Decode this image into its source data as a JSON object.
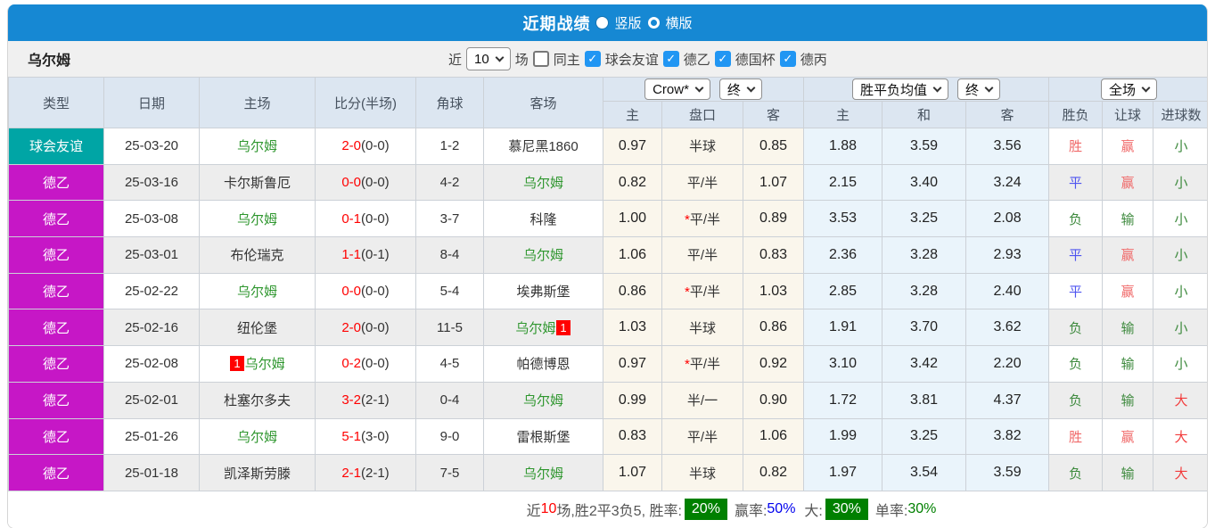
{
  "titlebar": {
    "title": "近期战绩",
    "vertical_label": "竖版",
    "horizontal_label": "横版",
    "vertical_selected": true
  },
  "filter": {
    "team": "乌尔姆",
    "recent_label": "近",
    "match_count": "10",
    "matches_label": "场",
    "same_home_label": "同主",
    "same_home_checked": false,
    "competitions": [
      {
        "label": "球会友谊",
        "checked": true
      },
      {
        "label": "德乙",
        "checked": true
      },
      {
        "label": "德国杯",
        "checked": true
      },
      {
        "label": "德丙",
        "checked": true
      }
    ]
  },
  "table": {
    "selectors": {
      "company": "Crow*",
      "company_time": "终",
      "avg_type": "胜平负均值",
      "avg_time": "终",
      "scope": "全场"
    },
    "columns": [
      "类型",
      "日期",
      "主场",
      "比分(半场)",
      "角球",
      "客场"
    ],
    "sub_columns": [
      "主",
      "盘口",
      "客",
      "主",
      "和",
      "客",
      "胜负",
      "让球",
      "进球数"
    ],
    "rows": [
      {
        "type": "球会友谊",
        "type_color": "teal",
        "date": "25-03-20",
        "home": "乌尔姆",
        "home_focus": true,
        "home_badge_before": "",
        "home_badge_after": "",
        "score_ft": "2-0",
        "score_ht": "(0-0)",
        "corners": "1-2",
        "away": "慕尼黑1860",
        "away_focus": false,
        "away_badge_before": "",
        "away_badge_after": "",
        "odds": [
          "0.97",
          "半球",
          "0.85"
        ],
        "handicap_star": false,
        "avg": [
          "1.88",
          "3.59",
          "3.56"
        ],
        "wdl": "胜",
        "wdl_color": "win-red",
        "handicap_result": "赢",
        "handicap_result_color": "win-red",
        "goals": "小",
        "goals_color": "small-green"
      },
      {
        "type": "德乙",
        "type_color": "magenta",
        "date": "25-03-16",
        "home": "卡尔斯鲁厄",
        "home_focus": false,
        "home_badge_before": "",
        "home_badge_after": "",
        "score_ft": "0-0",
        "score_ht": "(0-0)",
        "corners": "4-2",
        "away": "乌尔姆",
        "away_focus": true,
        "away_badge_before": "",
        "away_badge_after": "",
        "odds": [
          "0.82",
          "平/半",
          "1.07"
        ],
        "handicap_star": false,
        "avg": [
          "2.15",
          "3.40",
          "3.24"
        ],
        "wdl": "平",
        "wdl_color": "draw-blue",
        "handicap_result": "赢",
        "handicap_result_color": "win-red",
        "goals": "小",
        "goals_color": "small-green"
      },
      {
        "type": "德乙",
        "type_color": "magenta",
        "date": "25-03-08",
        "home": "乌尔姆",
        "home_focus": true,
        "home_badge_before": "",
        "home_badge_after": "",
        "score_ft": "0-1",
        "score_ht": "(0-0)",
        "corners": "3-7",
        "away": "科隆",
        "away_focus": false,
        "away_badge_before": "",
        "away_badge_after": "",
        "odds": [
          "1.00",
          "平/半",
          "0.89"
        ],
        "handicap_star": true,
        "avg": [
          "3.53",
          "3.25",
          "2.08"
        ],
        "wdl": "负",
        "wdl_color": "lose-green",
        "handicap_result": "输",
        "handicap_result_color": "lose-green",
        "goals": "小",
        "goals_color": "small-green"
      },
      {
        "type": "德乙",
        "type_color": "magenta",
        "date": "25-03-01",
        "home": "布伦瑞克",
        "home_focus": false,
        "home_badge_before": "",
        "home_badge_after": "",
        "score_ft": "1-1",
        "score_ht": "(0-1)",
        "corners": "8-4",
        "away": "乌尔姆",
        "away_focus": true,
        "away_badge_before": "",
        "away_badge_after": "",
        "odds": [
          "1.06",
          "平/半",
          "0.83"
        ],
        "handicap_star": false,
        "avg": [
          "2.36",
          "3.28",
          "2.93"
        ],
        "wdl": "平",
        "wdl_color": "draw-blue",
        "handicap_result": "赢",
        "handicap_result_color": "win-red",
        "goals": "小",
        "goals_color": "small-green"
      },
      {
        "type": "德乙",
        "type_color": "magenta",
        "date": "25-02-22",
        "home": "乌尔姆",
        "home_focus": true,
        "home_badge_before": "",
        "home_badge_after": "",
        "score_ft": "0-0",
        "score_ht": "(0-0)",
        "corners": "5-4",
        "away": "埃弗斯堡",
        "away_focus": false,
        "away_badge_before": "",
        "away_badge_after": "",
        "odds": [
          "0.86",
          "平/半",
          "1.03"
        ],
        "handicap_star": true,
        "avg": [
          "2.85",
          "3.28",
          "2.40"
        ],
        "wdl": "平",
        "wdl_color": "draw-blue",
        "handicap_result": "赢",
        "handicap_result_color": "win-red",
        "goals": "小",
        "goals_color": "small-green"
      },
      {
        "type": "德乙",
        "type_color": "magenta",
        "date": "25-02-16",
        "home": "纽伦堡",
        "home_focus": false,
        "home_badge_before": "",
        "home_badge_after": "",
        "score_ft": "2-0",
        "score_ht": "(0-0)",
        "corners": "11-5",
        "away": "乌尔姆",
        "away_focus": true,
        "away_badge_before": "",
        "away_badge_after": "1",
        "odds": [
          "1.03",
          "半球",
          "0.86"
        ],
        "handicap_star": false,
        "avg": [
          "1.91",
          "3.70",
          "3.62"
        ],
        "wdl": "负",
        "wdl_color": "lose-green",
        "handicap_result": "输",
        "handicap_result_color": "lose-green",
        "goals": "小",
        "goals_color": "small-green"
      },
      {
        "type": "德乙",
        "type_color": "magenta",
        "date": "25-02-08",
        "home": "乌尔姆",
        "home_focus": true,
        "home_badge_before": "1",
        "home_badge_after": "",
        "score_ft": "0-2",
        "score_ht": "(0-0)",
        "corners": "4-5",
        "away": "帕德博恩",
        "away_focus": false,
        "away_badge_before": "",
        "away_badge_after": "",
        "odds": [
          "0.97",
          "平/半",
          "0.92"
        ],
        "handicap_star": true,
        "avg": [
          "3.10",
          "3.42",
          "2.20"
        ],
        "wdl": "负",
        "wdl_color": "lose-green",
        "handicap_result": "输",
        "handicap_result_color": "lose-green",
        "goals": "小",
        "goals_color": "small-green"
      },
      {
        "type": "德乙",
        "type_color": "magenta",
        "date": "25-02-01",
        "home": "杜塞尔多夫",
        "home_focus": false,
        "home_badge_before": "",
        "home_badge_after": "",
        "score_ft": "3-2",
        "score_ht": "(2-1)",
        "corners": "0-4",
        "away": "乌尔姆",
        "away_focus": true,
        "away_badge_before": "",
        "away_badge_after": "",
        "odds": [
          "0.99",
          "半/一",
          "0.90"
        ],
        "handicap_star": false,
        "avg": [
          "1.72",
          "3.81",
          "4.37"
        ],
        "wdl": "负",
        "wdl_color": "lose-green",
        "handicap_result": "输",
        "handicap_result_color": "lose-green",
        "goals": "大",
        "goals_color": "big-red"
      },
      {
        "type": "德乙",
        "type_color": "magenta",
        "date": "25-01-26",
        "home": "乌尔姆",
        "home_focus": true,
        "home_badge_before": "",
        "home_badge_after": "",
        "score_ft": "5-1",
        "score_ht": "(3-0)",
        "corners": "9-0",
        "away": "雷根斯堡",
        "away_focus": false,
        "away_badge_before": "",
        "away_badge_after": "",
        "odds": [
          "0.83",
          "平/半",
          "1.06"
        ],
        "handicap_star": false,
        "avg": [
          "1.99",
          "3.25",
          "3.82"
        ],
        "wdl": "胜",
        "wdl_color": "win-red",
        "handicap_result": "赢",
        "handicap_result_color": "win-red",
        "goals": "大",
        "goals_color": "big-red"
      },
      {
        "type": "德乙",
        "type_color": "magenta",
        "date": "25-01-18",
        "home": "凯泽斯劳滕",
        "home_focus": false,
        "home_badge_before": "",
        "home_badge_after": "",
        "score_ft": "2-1",
        "score_ht": "(2-1)",
        "corners": "7-5",
        "away": "乌尔姆",
        "away_focus": true,
        "away_badge_before": "",
        "away_badge_after": "",
        "odds": [
          "1.07",
          "半球",
          "0.82"
        ],
        "handicap_star": false,
        "avg": [
          "1.97",
          "3.54",
          "3.59"
        ],
        "wdl": "负",
        "wdl_color": "lose-green",
        "handicap_result": "输",
        "handicap_result_color": "lose-green",
        "goals": "大",
        "goals_color": "big-red"
      }
    ]
  },
  "summary": {
    "recent_label": "近",
    "recent_count": "10",
    "record_text": "场,胜2平3负5, 胜率:",
    "win_rate": "20%",
    "handicap_rate_label": "赢率:",
    "handicap_rate": "50%",
    "big_label": "大:",
    "big_rate": "30%",
    "single_label": "单率:",
    "single_rate": "30%"
  },
  "colors": {
    "titlebar_blue": "#1688d3",
    "friendly_teal": "#00a5a5",
    "league_magenta": "#c617c6",
    "focus_team_green": "#2e962e",
    "score_red": "#ff0000",
    "win_red": "#f06a6a",
    "draw_blue": "#4f55f0",
    "lose_green": "#3e8a3e",
    "big_red": "#f23c3c",
    "rate_badge_green": "#008000",
    "rate_blue": "#0000ee",
    "checkbox_blue": "#2196f3",
    "handicap_bg": "#faf6ec",
    "avg_bg": "#eaf4fb",
    "header_bg": "#dce6f1"
  }
}
